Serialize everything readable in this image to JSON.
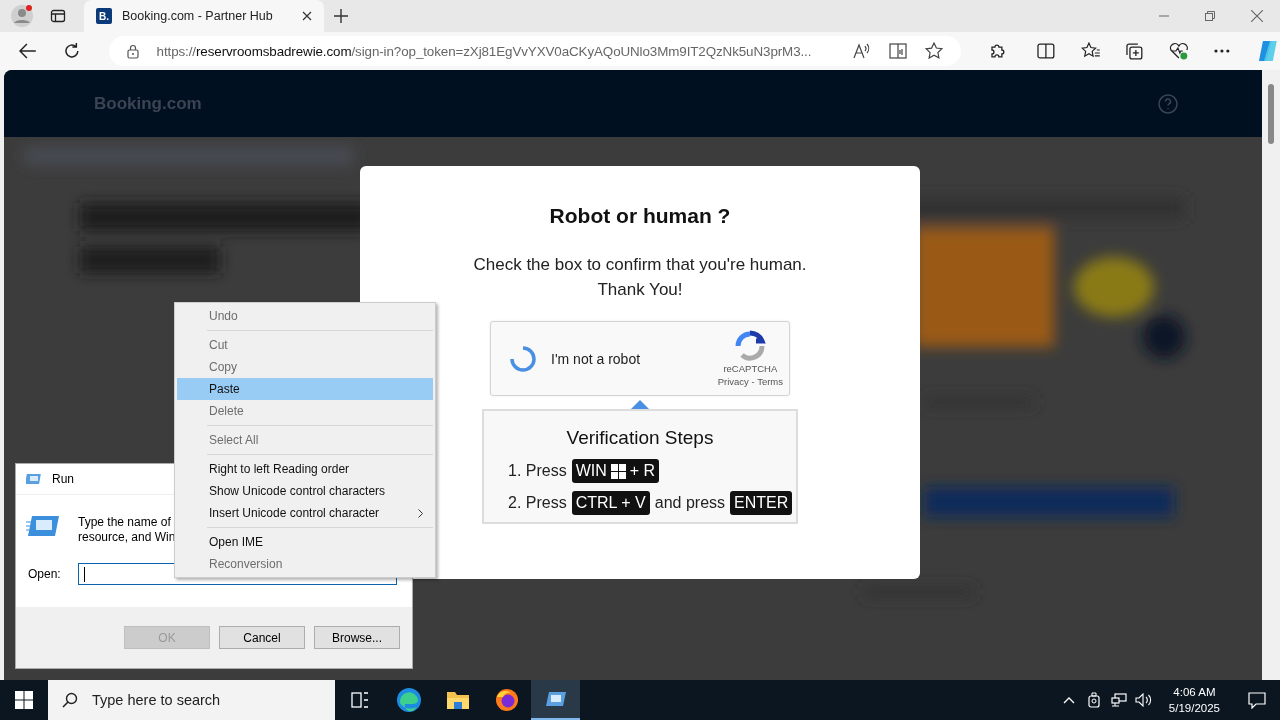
{
  "browser": {
    "tabs": [
      {
        "title": "Booking.com - Partner Hub",
        "favicon": "B.",
        "selected": true
      }
    ],
    "address": {
      "scheme": "https://",
      "host": "reservroomsbadrewie.com",
      "rest": "/sign-in?op_token=zXj81EgVvYXV0aCKyAQoUNlo3Mm9IT2QzNk5uN3prM3..."
    }
  },
  "page": {
    "logo": "Booking.com"
  },
  "modal": {
    "title": "Robot or human ?",
    "message": [
      "Check the box to confirm that you're human.",
      "Thank You!"
    ],
    "captcha": {
      "label": "I'm not a robot",
      "brand": "reCAPTCHA",
      "links": [
        "Privacy",
        "Terms"
      ],
      "separator": "-"
    },
    "steps_title": "Verification Steps",
    "steps": [
      [
        {
          "kind": "text",
          "text": "1. Press"
        },
        {
          "kind": "key",
          "parts": [
            {
              "kind": "text",
              "text": "WIN"
            },
            {
              "kind": "logo"
            },
            {
              "kind": "text",
              "text": "+ R"
            }
          ]
        }
      ],
      [
        {
          "kind": "text",
          "text": "2. Press"
        },
        {
          "kind": "key",
          "parts": [
            {
              "kind": "text",
              "text": "CTRL + V"
            }
          ]
        },
        {
          "kind": "text",
          "text": "and press"
        },
        {
          "kind": "key",
          "parts": [
            {
              "kind": "text",
              "text": "ENTER"
            }
          ]
        }
      ]
    ]
  },
  "run_dialog": {
    "title": "Run",
    "description": [
      "Type the name of",
      "resource, and Win"
    ],
    "open_label": "Open:",
    "buttons": [
      {
        "label": "OK",
        "disabled": true
      },
      {
        "label": "Cancel",
        "disabled": false
      },
      {
        "label": "Browse...",
        "disabled": false
      }
    ]
  },
  "context_menu": [
    {
      "label": "Undo",
      "disabled": true,
      "selected": false,
      "separator_after": true,
      "submenu": false
    },
    {
      "label": "Cut",
      "disabled": true,
      "selected": false,
      "separator_after": false,
      "submenu": false
    },
    {
      "label": "Copy",
      "disabled": true,
      "selected": false,
      "separator_after": false,
      "submenu": false
    },
    {
      "label": "Paste",
      "disabled": false,
      "selected": true,
      "separator_after": false,
      "submenu": false
    },
    {
      "label": "Delete",
      "disabled": true,
      "selected": false,
      "separator_after": true,
      "submenu": false
    },
    {
      "label": "Select All",
      "disabled": true,
      "selected": false,
      "separator_after": true,
      "submenu": false
    },
    {
      "label": "Right to left Reading order",
      "disabled": false,
      "selected": false,
      "separator_after": false,
      "submenu": false
    },
    {
      "label": "Show Unicode control characters",
      "disabled": false,
      "selected": false,
      "separator_after": false,
      "submenu": false
    },
    {
      "label": "Insert Unicode control character",
      "disabled": false,
      "selected": false,
      "separator_after": true,
      "submenu": true
    },
    {
      "label": "Open IME",
      "disabled": false,
      "selected": false,
      "separator_after": false,
      "submenu": false
    },
    {
      "label": "Reconversion",
      "disabled": true,
      "selected": false,
      "separator_after": false,
      "submenu": false
    }
  ],
  "taskbar": {
    "search_placeholder": "Type here to search",
    "apps": [
      {
        "kind": "taskview",
        "selected": false
      },
      {
        "kind": "edge",
        "selected": false
      },
      {
        "kind": "explorer",
        "selected": false
      },
      {
        "kind": "firefox",
        "selected": false
      },
      {
        "kind": "run",
        "selected": true
      }
    ],
    "time": "4:06 AM",
    "date": "5/19/2025"
  }
}
